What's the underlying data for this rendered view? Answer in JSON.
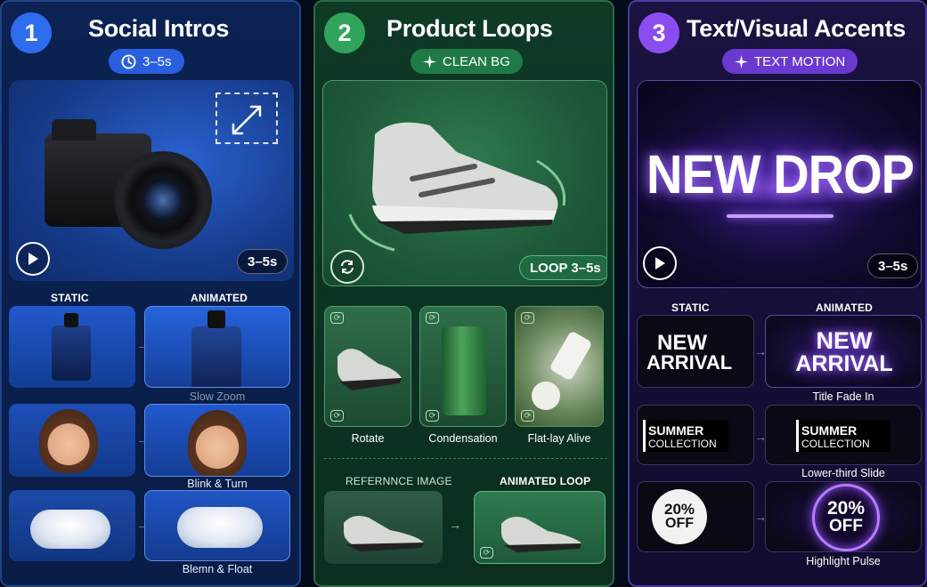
{
  "panels": [
    {
      "number": "1",
      "title": "Social Intros",
      "pill": "3–5s",
      "hero_duration": "3–5s",
      "col_static": "STATIC",
      "col_animated": "ANIMATED",
      "examples": [
        "Slow Zoom",
        "Blink & Turn",
        "Blemn & Float"
      ]
    },
    {
      "number": "2",
      "title": "Product Loops",
      "pill": "CLEAN BG",
      "hero_tag": "LOOP 3–5s",
      "examples": [
        "Rotate",
        "Condensation",
        "Flat-lay Alive"
      ],
      "ref_label": "REFERNNCE IMAGE",
      "loop_label": "ANIMATED LOOP"
    },
    {
      "number": "3",
      "title": "Text/Visual Accents",
      "pill": "TEXT MOTION",
      "hero_text": "NEW DROP",
      "hero_duration": "3–5s",
      "col_static": "STATIC",
      "col_animated": "ANIMATED",
      "rows": [
        {
          "line1": "NEW",
          "line2": "ARRIVAL",
          "caption": "Title Fade In"
        },
        {
          "line1": "SUMMER",
          "line2": "COLLECTION",
          "caption": "Lower-third Slide"
        },
        {
          "line1": "20%",
          "line2": "OFF",
          "caption": "Highlight Pulse"
        }
      ]
    }
  ],
  "colors": {
    "blue": "#2f6df0",
    "green": "#2fa45a",
    "purple": "#8a4ef0"
  },
  "icons": [
    "clock-icon",
    "sparkle-icon",
    "play-icon",
    "expand-icon",
    "loop-icon",
    "arrow-right-icon"
  ]
}
